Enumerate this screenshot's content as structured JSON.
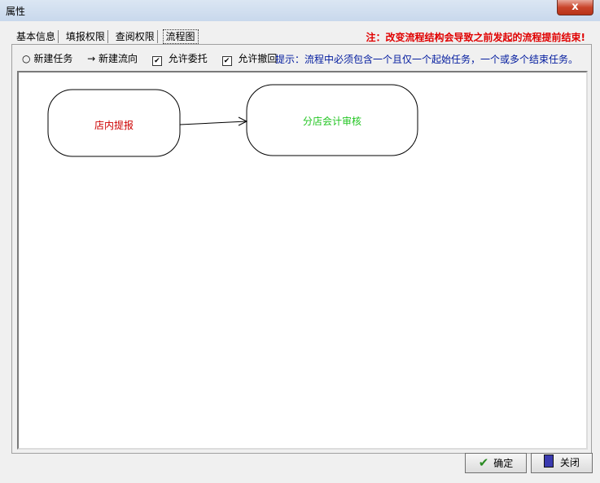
{
  "window": {
    "title": "属性",
    "close_symbol": "x"
  },
  "tabs": [
    {
      "label": "基本信息",
      "active": false
    },
    {
      "label": "填报权限",
      "active": false
    },
    {
      "label": "查阅权限",
      "active": false
    },
    {
      "label": "流程图",
      "active": true
    }
  ],
  "warning": "注：改变流程结构会导致之前发起的流程提前结束!",
  "toolbar": {
    "new_task": {
      "icon": "○",
      "label": "新建任务"
    },
    "new_flow": {
      "icon": "→",
      "label": "新建流向"
    },
    "allow_delegate": {
      "label": "允许委托",
      "checked": true
    },
    "allow_withdraw": {
      "label": "允许撤回",
      "checked": true
    },
    "check_mark": "✔"
  },
  "hint": "提示：流程中必须包含一个且仅一个起始任务，一个或多个结束任务。",
  "flow": {
    "node1": {
      "label": "店内提报",
      "color": "#cc0000"
    },
    "node2": {
      "label": "分店会计审核",
      "color": "#22c522"
    }
  },
  "buttons": {
    "ok": {
      "label": "确定",
      "icon": "check-icon"
    },
    "close": {
      "label": "关闭",
      "icon": "door-icon"
    }
  }
}
